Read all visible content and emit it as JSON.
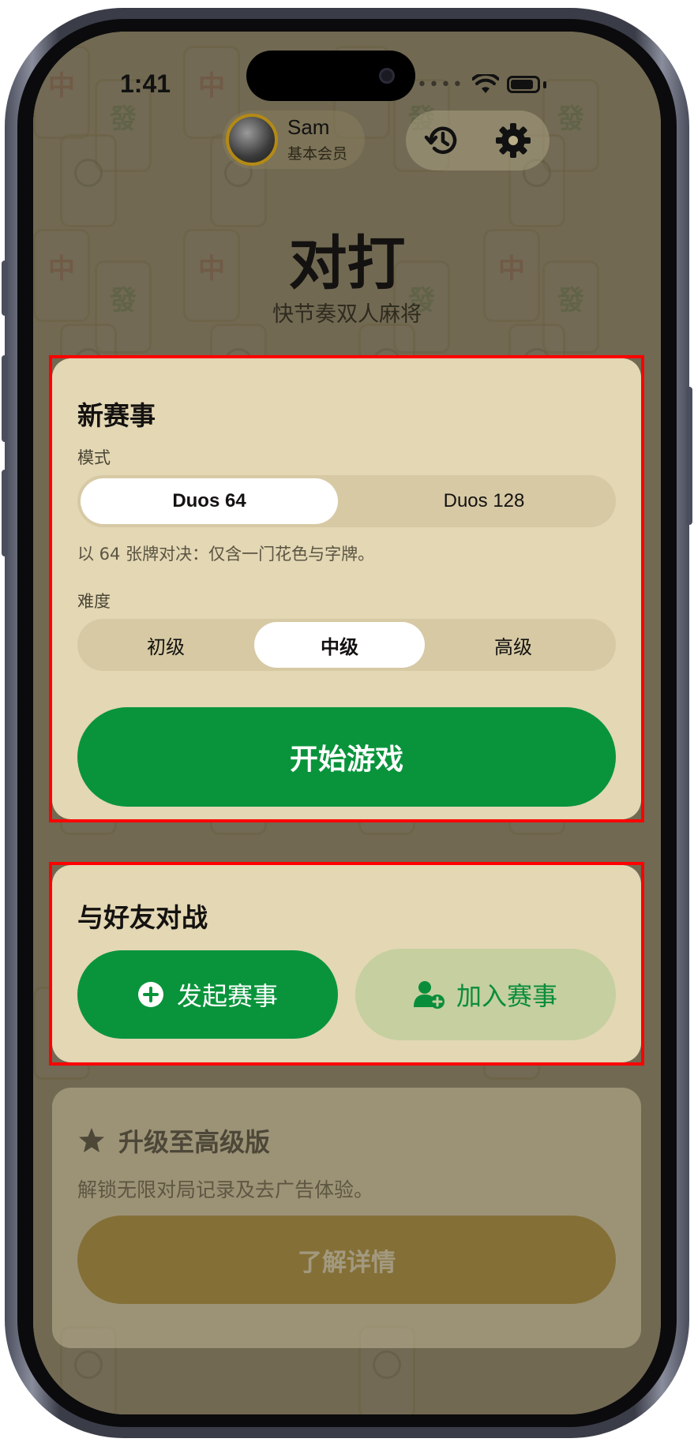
{
  "status_bar": {
    "time": "1:41"
  },
  "profile": {
    "name": "Sam",
    "tier": "基本会员"
  },
  "header_actions": {
    "history_icon": "history-icon",
    "settings_icon": "gear-icon"
  },
  "app": {
    "title": "对打",
    "subtitle": "快节奏双人麻将"
  },
  "new_match": {
    "title": "新赛事",
    "mode_label": "模式",
    "modes": [
      "Duos 64",
      "Duos 128"
    ],
    "selected_mode": "Duos 64",
    "mode_hint": "以 64 张牌对决：仅含一门花色与字牌。",
    "difficulty_label": "难度",
    "difficulties": [
      "初级",
      "中级",
      "高级"
    ],
    "selected_difficulty": "中级",
    "start_label": "开始游戏"
  },
  "friends": {
    "title": "与好友对战",
    "host_label": "发起赛事",
    "join_label": "加入赛事"
  },
  "promo": {
    "title": "升级至高级版",
    "text": "解锁无限对局记录及去广告体验。",
    "button_label": "了解详情"
  },
  "colors": {
    "primary_green": "#09943b",
    "card_bg": "#e3d7b4",
    "join_bg": "#c5cf9f",
    "promo_gold": "#a57d0c",
    "highlight": "#ff0000"
  }
}
